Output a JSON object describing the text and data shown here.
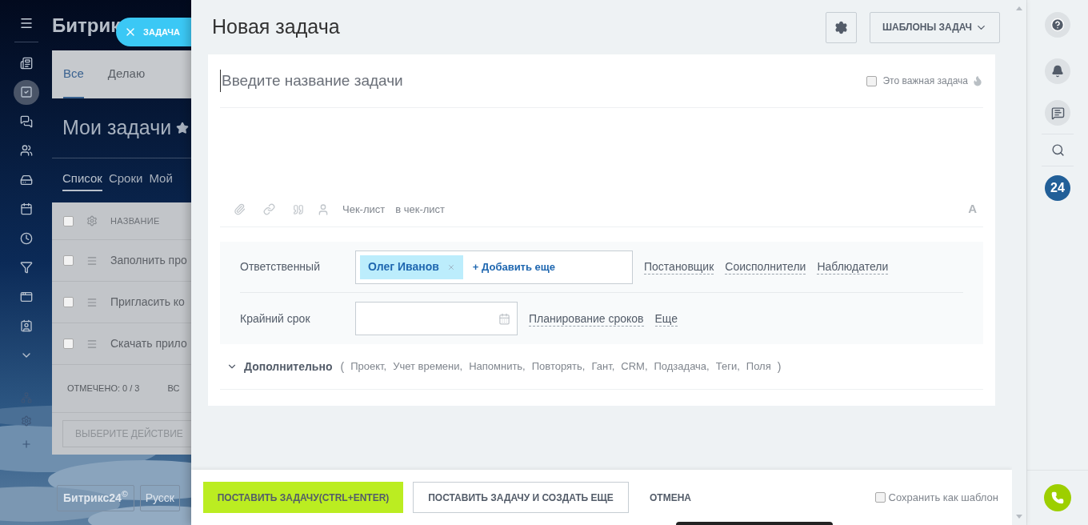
{
  "left_rail": {
    "items": [
      {
        "selected": false
      },
      {
        "selected": true
      },
      {
        "selected": false
      },
      {
        "selected": false
      },
      {
        "selected": false
      },
      {
        "selected": false
      },
      {
        "selected": false
      },
      {
        "selected": false
      },
      {
        "selected": false
      },
      {
        "selected": false
      },
      {
        "selected": false
      }
    ]
  },
  "background_page": {
    "header_title": "Битрик",
    "close_tab_label": "ЗАДАЧА",
    "tabs": [
      {
        "label": "Все",
        "selected": true
      },
      {
        "label": "Делаю",
        "selected": false
      }
    ],
    "page_title": "Мои задачи",
    "view_tabs": [
      {
        "label": "Список",
        "selected": true
      },
      {
        "label": "Сроки",
        "selected": false
      },
      {
        "label": "Мой",
        "selected": false
      }
    ],
    "table": {
      "columns": [
        "НАЗВАНИЕ"
      ],
      "rows": [
        {
          "title": "Заполнить про",
          "checked": false
        },
        {
          "title": "Пригласить ко",
          "checked": false
        },
        {
          "title": "Скачать прило",
          "checked": false
        }
      ],
      "header_checked": false
    },
    "footer_marked": "ОТМЕЧЕНО: 0 / 3",
    "footer_column_2": "ВС",
    "action_select": "ВЫБЕРИТЕ ДЕЙСТВИЕ",
    "footer_logo": "Битрикс24$^{©}$",
    "language": "Русск"
  },
  "task_panel": {
    "title": "Новая задача",
    "templates_button": "ШАБЛОНЫ ЗАДАЧ",
    "title_field": {
      "placeholder": "Введите название задачи"
    },
    "important": {
      "label": "Это важная задача",
      "checked": false
    },
    "toolbar": {
      "items": [
        "Чек-лист",
        "в чек-лист"
      ],
      "format_button": "A"
    },
    "responsible": {
      "label": "Ответственный",
      "people": [
        {
          "name": "Олег Иванов"
        }
      ],
      "add_more": "+ Добавить еще",
      "role_links": [
        "Постановщик",
        "Соисполнители",
        "Наблюдатели"
      ]
    },
    "deadline": {
      "label": "Крайний срок",
      "links": [
        "Планирование сроков",
        "Еще"
      ]
    },
    "additional": {
      "label": "Дополнительно",
      "expanded": false,
      "paren_open": "(",
      "paren_close": ")",
      "items": [
        "Проект,",
        "Учет времени,",
        "Напомнить,",
        "Повторять,",
        "Гант,",
        "CRM,",
        "Подзадача,",
        "Теги,",
        "Поля"
      ]
    },
    "footer": {
      "submit_button": "ПОСТАВИТЬ ЗАДАЧУ(CTRL+ENTER)",
      "submit_more_button": "ПОСТАВИТЬ ЗАДАЧУ И СОЗДАТЬ ЕЩЕ",
      "cancel_button": "ОТМЕНА",
      "save_template": {
        "label": "Сохранить как шаблон",
        "checked": false
      }
    }
  },
  "right_bar": {
    "badge": "24"
  }
}
